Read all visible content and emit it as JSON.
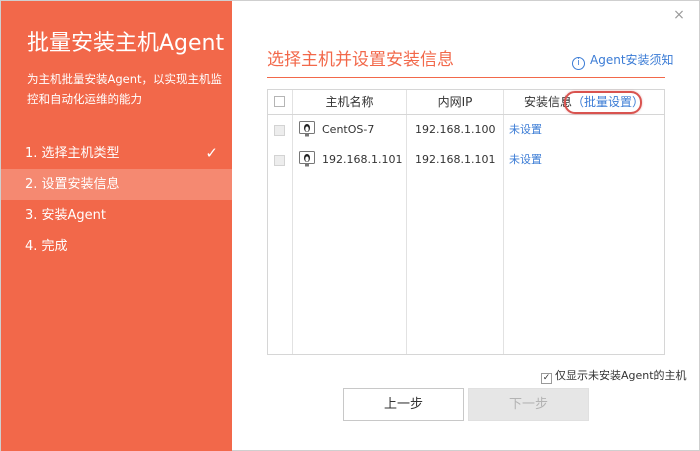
{
  "sidebar": {
    "title": "批量安装主机Agent",
    "description": "为主机批量安装Agent，以实现主机监控和自动化运维的能力",
    "steps": [
      {
        "label": "1. 选择主机类型",
        "done": true
      },
      {
        "label": "2. 设置安装信息",
        "active": true
      },
      {
        "label": "3. 安装Agent"
      },
      {
        "label": "4. 完成"
      }
    ],
    "check_glyph": "✓"
  },
  "window": {
    "close_glyph": "×"
  },
  "main": {
    "title": "选择主机并设置安装信息",
    "help_link": "Agent安装须知",
    "help_icon": "ⓘ"
  },
  "table": {
    "columns": [
      "主机名称",
      "内网IP",
      "安装信息"
    ],
    "batch_setting": "（批量设置）",
    "rows": [
      {
        "host": "CentOS-7",
        "ip": "192.168.1.100",
        "install_info": "未设置"
      },
      {
        "host": "192.168.1.101",
        "ip": "192.168.1.101",
        "install_info": "未设置"
      }
    ]
  },
  "filter": {
    "label": "仅显示未安装Agent的主机",
    "checked": true
  },
  "buttons": {
    "prev": "上一步",
    "next": "下一步"
  },
  "colors": {
    "accent": "#f2684a",
    "link": "#3a7bd5",
    "highlight": "#d9534f"
  },
  "icons": {
    "host": "linux-monitor-icon",
    "info": "info-icon",
    "close": "close-icon",
    "check": "check-icon"
  }
}
